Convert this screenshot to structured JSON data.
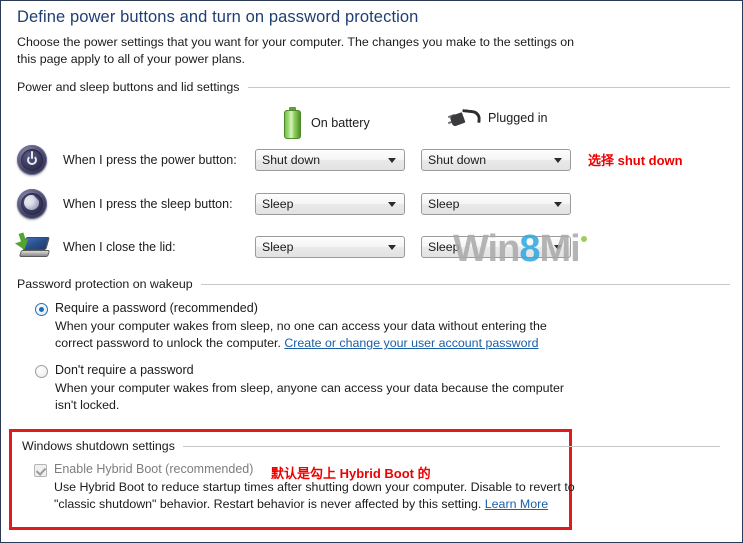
{
  "header": {
    "title": "Define power buttons and turn on password protection",
    "description": "Choose the power settings that you want for your computer. The changes you make to the settings on this page apply to all of your power plans."
  },
  "groups": {
    "power_buttons": "Power and sleep buttons and lid settings",
    "password_protection": "Password protection on wakeup",
    "windows_shutdown": "Windows shutdown settings"
  },
  "columns": [
    {
      "icon": "battery-icon",
      "label": "On battery"
    },
    {
      "icon": "power-plug-icon",
      "label": "Plugged in"
    }
  ],
  "rows": [
    {
      "icon": "power-button-icon",
      "label": "When I press the power button:",
      "on_battery": "Shut down",
      "plugged_in": "Shut down"
    },
    {
      "icon": "sleep-button-icon",
      "label": "When I press the sleep button:",
      "on_battery": "Sleep",
      "plugged_in": "Sleep"
    },
    {
      "icon": "laptop-lid-icon",
      "label": "When I close the lid:",
      "on_battery": "Sleep",
      "plugged_in": "Sleep"
    }
  ],
  "password_options": [
    {
      "title": "Require a password (recommended)",
      "selected": true,
      "description_before_link": "When your computer wakes from sleep, no one can access your data without entering the correct password to unlock the computer. ",
      "link": "Create or change your user account password"
    },
    {
      "title": "Don't require a password",
      "selected": false,
      "description_before_link": "When your computer wakes from sleep, anyone can access your data because the computer isn't locked.",
      "link": ""
    }
  ],
  "hybrid_boot": {
    "checkbox_label": "Enable Hybrid Boot (recommended)",
    "checked": true,
    "disabled": true,
    "description_before_link": "Use Hybrid Boot to reduce startup times after shutting down your computer. Disable to revert to \"classic shutdown\" behavior. Restart behavior is never affected by this setting. ",
    "link": "Learn More"
  },
  "annotations": {
    "shutdown_note": "选择 shut down",
    "hybrid_note": "默认是勾上 Hybrid Boot 的",
    "color": "#ee0000"
  },
  "watermark": {
    "part1": "Win",
    "highlight": "8",
    "part2": "Mi"
  },
  "colors": {
    "title": "#1f3f73",
    "link": "#1a5fa8",
    "annotation": "#ee0000",
    "red_box_border": "#e01b1b",
    "battery_green": "#78bf4d"
  }
}
